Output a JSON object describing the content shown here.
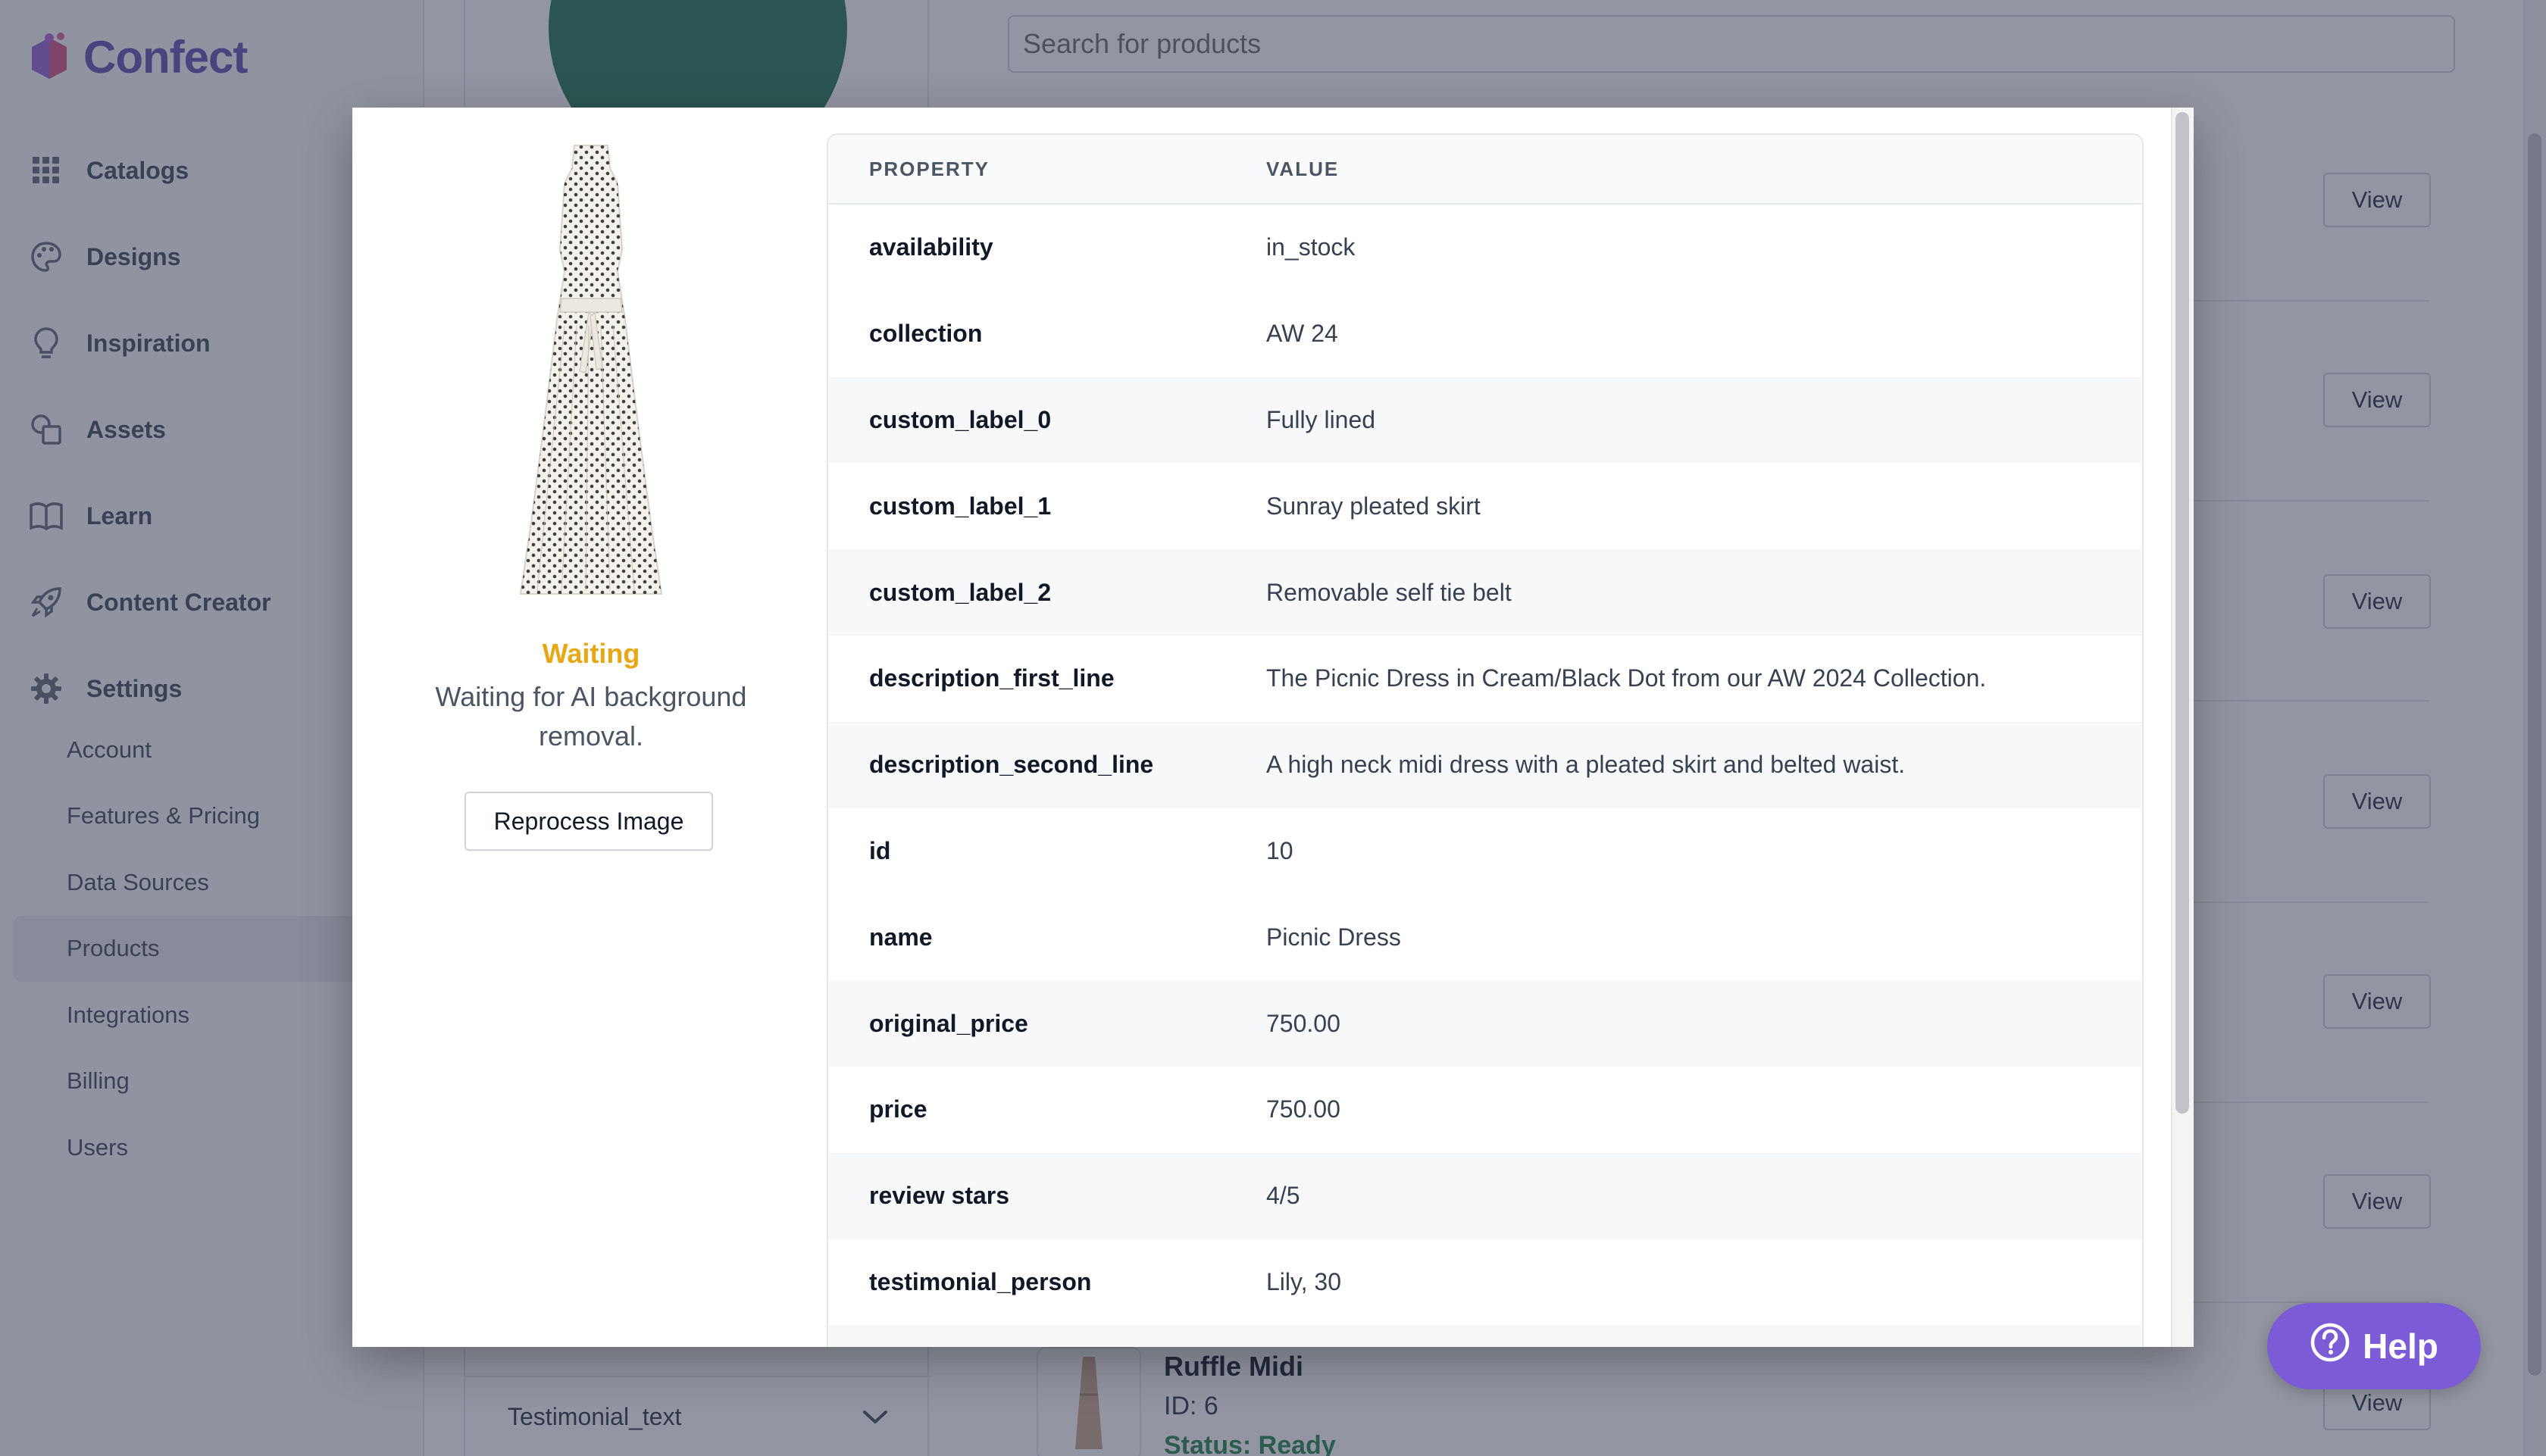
{
  "app": {
    "brand": "Confect",
    "brand_color": "#6b5bb5",
    "nav": [
      {
        "label": "Catalogs",
        "icon": "grid-icon"
      },
      {
        "label": "Designs",
        "icon": "palette-icon"
      },
      {
        "label": "Inspiration",
        "icon": "lightbulb-icon"
      },
      {
        "label": "Assets",
        "icon": "shapes-icon"
      },
      {
        "label": "Learn",
        "icon": "book-icon"
      },
      {
        "label": "Content Creator",
        "icon": "rocket-icon"
      },
      {
        "label": "Settings",
        "icon": "gear-icon"
      }
    ],
    "settings_sub": [
      {
        "label": "Account",
        "active": false
      },
      {
        "label": "Features & Pricing",
        "active": false
      },
      {
        "label": "Data Sources",
        "active": false
      },
      {
        "label": "Products",
        "active": true
      },
      {
        "label": "Integrations",
        "active": false
      },
      {
        "label": "Billing",
        "active": false
      },
      {
        "label": "Users",
        "active": false
      }
    ],
    "filter_bottom_label": "Testimonial_text",
    "search_placeholder": "Search for products",
    "view_label": "View",
    "last_product": {
      "name": "Ruffle Midi",
      "id": "ID: 6",
      "status": "Status: Ready",
      "status_color": "#2e8b57"
    },
    "help_label": "Help",
    "help_color": "#7c5cd6"
  },
  "modal": {
    "status_title": "Waiting",
    "status_color": "#e6a817",
    "status_desc": "Waiting for AI background removal.",
    "reprocess_label": "Reprocess Image",
    "table": {
      "col_property": "PROPERTY",
      "col_value": "VALUE",
      "rows": [
        {
          "property": "availability",
          "value": "in_stock"
        },
        {
          "property": "collection",
          "value": "AW 24"
        },
        {
          "property": "custom_label_0",
          "value": "Fully lined"
        },
        {
          "property": "custom_label_1",
          "value": "Sunray pleated skirt"
        },
        {
          "property": "custom_label_2",
          "value": "Removable self tie belt"
        },
        {
          "property": "description_first_line",
          "value": "The Picnic Dress in Cream/Black Dot from our AW 2024 Collection."
        },
        {
          "property": "description_second_line",
          "value": "A high neck midi dress with a pleated skirt and belted waist."
        },
        {
          "property": "id",
          "value": "10"
        },
        {
          "property": "name",
          "value": "Picnic Dress"
        },
        {
          "property": "original_price",
          "value": "750.00"
        },
        {
          "property": "price",
          "value": "750.00"
        },
        {
          "property": "review stars",
          "value": "4/5"
        },
        {
          "property": "testimonial_person",
          "value": "Lily, 30"
        }
      ]
    }
  }
}
